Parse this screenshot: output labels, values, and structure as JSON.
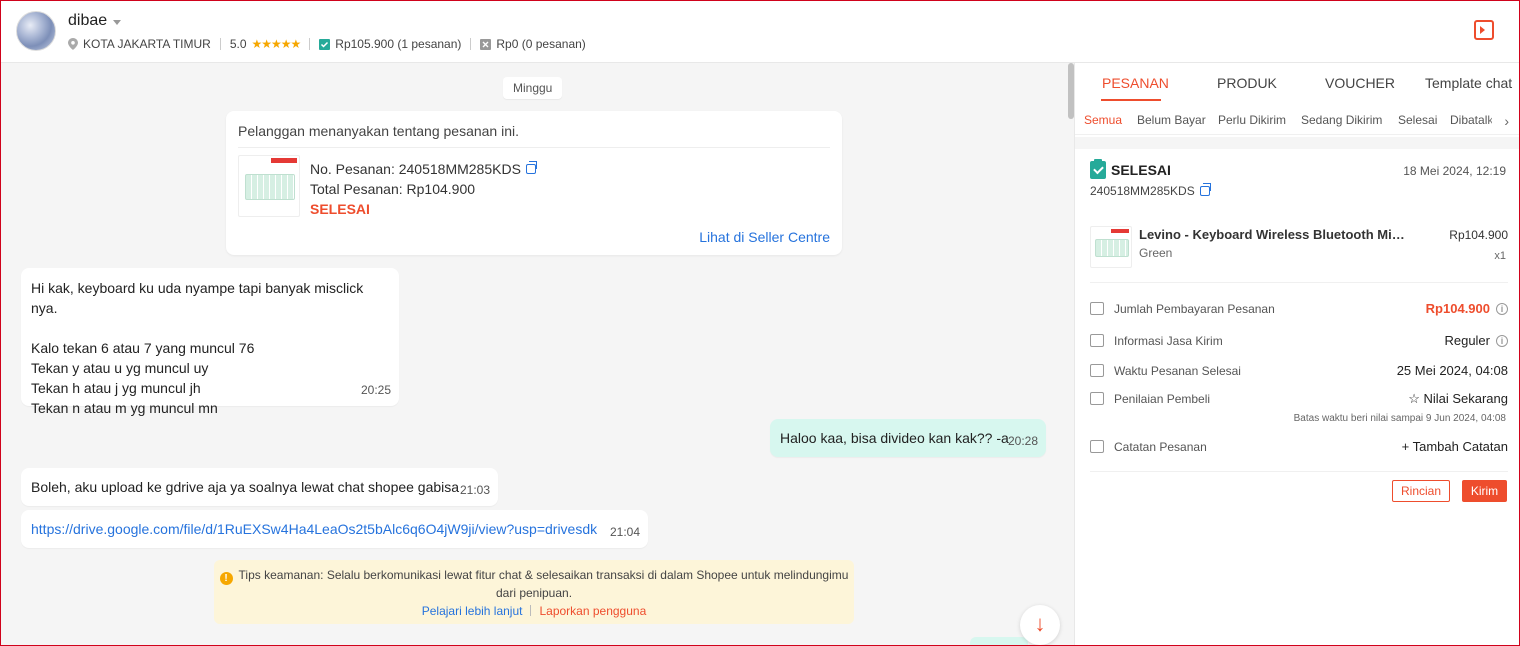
{
  "header": {
    "username": "dibae",
    "location": "KOTA JAKARTA TIMUR",
    "rating": "5.0",
    "stars": "★★★★★",
    "paid_orders": "Rp105.900 (1 pesanan)",
    "unpaid_orders": "Rp0 (0 pesanan)"
  },
  "chat": {
    "day_label": "Minggu",
    "order_card": {
      "title": "Pelanggan menanyakan tentang pesanan ini.",
      "order_no": "No. Pesanan: 240518MM285KDS",
      "total": "Total Pesanan: Rp104.900",
      "status": "SELESAI",
      "link": "Lihat di Seller Centre"
    },
    "messages": [
      {
        "from": "buyer",
        "text": "Hi kak, keyboard ku uda nyampe tapi banyak misclick nya.\n\nKalo tekan 6 atau 7 yang muncul 76\nTekan y atau u yg muncul uy\nTekan h atau j yg muncul jh\nTekan n atau m yg muncul mn",
        "time": "20:25"
      },
      {
        "from": "seller",
        "text": "Haloo kaa, bisa divideo kan kak?? -a",
        "time": "20:28"
      },
      {
        "from": "buyer",
        "text": "Boleh, aku upload ke gdrive aja ya soalnya lewat chat shopee gabisa",
        "time": "21:03"
      },
      {
        "from": "buyer",
        "text": "https://drive.google.com/file/d/1RuEXSw4Ha4LeaOs2t5bAlc6q6O4jW9ji/view?usp=drivesdk",
        "time": "21:04"
      }
    ],
    "tips": {
      "text": "Tips keamanan: Selalu berkomunikasi lewat fitur chat & selesaikan transaksi di dalam Shopee untuk melindungimu dari penipuan.",
      "learn_more": "Pelajari lebih lanjut",
      "report": "Laporkan pengguna"
    },
    "scroll_down_glyph": "↓"
  },
  "panel": {
    "tabs": [
      "PESANAN",
      "PRODUK",
      "VOUCHER",
      "Template chat"
    ],
    "subtabs": [
      "Semua",
      "Belum Bayar",
      "Perlu Dikirim",
      "Sedang Dikirim",
      "Selesai",
      "Dibatalkan"
    ],
    "subtab_arrow": "›",
    "order": {
      "status": "SELESAI",
      "date": "18 Mei 2024, 12:19",
      "order_no": "240518MM285KDS",
      "product_name": "Levino - Keyboard Wireless Bluetooth Mini Slim Lightweight",
      "variant": "Green",
      "price": "Rp104.900",
      "qty": "x1",
      "rows": {
        "payment_label": "Jumlah Pembayaran Pesanan",
        "payment_value": "Rp104.900",
        "shipping_label": "Informasi Jasa Kirim",
        "shipping_value": "Reguler",
        "completed_label": "Waktu Pesanan Selesai",
        "completed_value": "25 Mei 2024, 04:08",
        "review_label": "Penilaian Pembeli",
        "review_value": "☆ Nilai Sekarang",
        "review_deadline": "Batas waktu beri nilai sampai 9 Jun 2024, 04:08",
        "note_label": "Catatan Pesanan",
        "note_value": "+ Tambah Catatan"
      },
      "btn_detail": "Rincian",
      "btn_send": "Kirim"
    }
  },
  "colors": {
    "accent": "#ee4d2d",
    "link": "#2673dd",
    "success": "#26aa99",
    "seller_bubble": "#d7f7ef"
  }
}
